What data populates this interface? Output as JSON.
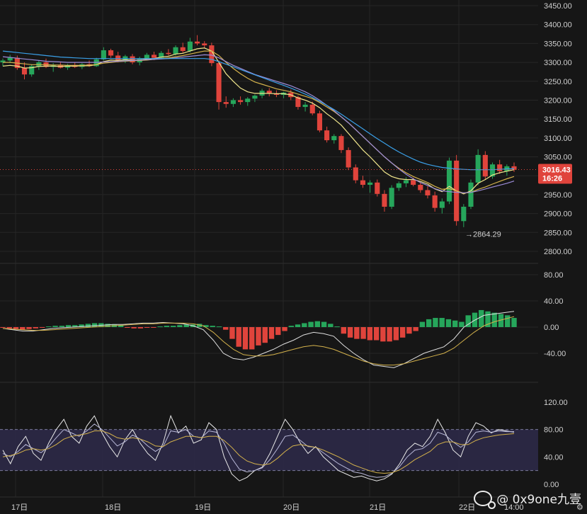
{
  "chart_data": [
    {
      "type": "candlestick",
      "panel": "price",
      "yticks": [
        "3450.00",
        "3400.00",
        "3350.00",
        "3300.00",
        "3250.00",
        "3200.00",
        "3150.00",
        "3100.00",
        "3050.00",
        "3000.00",
        "2950.00",
        "2900.00",
        "2850.00",
        "2800.00"
      ],
      "ylim": [
        2800,
        3450
      ],
      "last_price": "3016.43",
      "countdown": "16:26",
      "low_marker": "2864.29",
      "candles": [
        [
          3300,
          3310,
          3290,
          3305
        ],
        [
          3305,
          3320,
          3298,
          3312
        ],
        [
          3312,
          3318,
          3280,
          3285
        ],
        [
          3285,
          3300,
          3255,
          3268
        ],
        [
          3268,
          3295,
          3262,
          3290
        ],
        [
          3290,
          3305,
          3280,
          3300
        ],
        [
          3300,
          3310,
          3285,
          3288
        ],
        [
          3288,
          3298,
          3275,
          3292
        ],
        [
          3292,
          3300,
          3284,
          3286
        ],
        [
          3286,
          3296,
          3280,
          3293
        ],
        [
          3293,
          3300,
          3285,
          3288
        ],
        [
          3288,
          3298,
          3282,
          3295
        ],
        [
          3295,
          3305,
          3288,
          3290
        ],
        [
          3290,
          3312,
          3288,
          3308
        ],
        [
          3308,
          3340,
          3305,
          3332
        ],
        [
          3332,
          3336,
          3312,
          3318
        ],
        [
          3318,
          3328,
          3300,
          3305
        ],
        [
          3305,
          3320,
          3298,
          3316
        ],
        [
          3316,
          3322,
          3295,
          3300
        ],
        [
          3300,
          3315,
          3292,
          3310
        ],
        [
          3310,
          3325,
          3305,
          3320
        ],
        [
          3320,
          3328,
          3306,
          3312
        ],
        [
          3312,
          3330,
          3308,
          3325
        ],
        [
          3325,
          3335,
          3318,
          3322
        ],
        [
          3322,
          3345,
          3318,
          3340
        ],
        [
          3340,
          3352,
          3325,
          3330
        ],
        [
          3330,
          3365,
          3326,
          3355
        ],
        [
          3355,
          3372,
          3345,
          3350
        ],
        [
          3350,
          3356,
          3338,
          3345
        ],
        [
          3345,
          3352,
          3290,
          3298
        ],
        [
          3298,
          3305,
          3175,
          3195
        ],
        [
          3195,
          3210,
          3180,
          3190
        ],
        [
          3190,
          3205,
          3182,
          3200
        ],
        [
          3200,
          3210,
          3188,
          3195
        ],
        [
          3195,
          3208,
          3185,
          3204
        ],
        [
          3204,
          3215,
          3195,
          3212
        ],
        [
          3212,
          3230,
          3205,
          3225
        ],
        [
          3225,
          3232,
          3210,
          3218
        ],
        [
          3218,
          3226,
          3208,
          3214
        ],
        [
          3214,
          3222,
          3205,
          3220
        ],
        [
          3220,
          3228,
          3200,
          3208
        ],
        [
          3208,
          3212,
          3175,
          3182
        ],
        [
          3182,
          3195,
          3170,
          3188
        ],
        [
          3188,
          3196,
          3160,
          3165
        ],
        [
          3165,
          3172,
          3115,
          3120
        ],
        [
          3120,
          3130,
          3088,
          3094
        ],
        [
          3094,
          3110,
          3085,
          3105
        ],
        [
          3105,
          3110,
          3060,
          3068
        ],
        [
          3068,
          3075,
          3015,
          3022
        ],
        [
          3022,
          3030,
          2980,
          2988
        ],
        [
          2988,
          3000,
          2968,
          2976
        ],
        [
          2976,
          2988,
          2955,
          2982
        ],
        [
          2982,
          2990,
          2945,
          2952
        ],
        [
          2952,
          2962,
          2905,
          2918
        ],
        [
          2918,
          2975,
          2912,
          2968
        ],
        [
          2968,
          2985,
          2960,
          2980
        ],
        [
          2980,
          2996,
          2970,
          2988
        ],
        [
          2988,
          2995,
          2972,
          2976
        ],
        [
          2976,
          2982,
          2955,
          2962
        ],
        [
          2962,
          2972,
          2940,
          2948
        ],
        [
          2948,
          2958,
          2905,
          2915
        ],
        [
          2915,
          2940,
          2900,
          2932
        ],
        [
          2932,
          3048,
          2925,
          3040
        ],
        [
          3040,
          3055,
          2868,
          2880
        ],
        [
          2880,
          2925,
          2864,
          2918
        ],
        [
          2918,
          2990,
          2912,
          2982
        ],
        [
          2982,
          3070,
          2975,
          3055
        ],
        [
          3055,
          3065,
          2990,
          2998
        ],
        [
          2998,
          3035,
          2992,
          3030
        ],
        [
          3030,
          3042,
          3005,
          3012
        ],
        [
          3012,
          3030,
          3000,
          3025
        ],
        [
          3025,
          3035,
          3010,
          3016
        ]
      ],
      "series": [
        {
          "name": "",
          "color": "#f0e68c",
          "values": [
            3290,
            3292,
            3290,
            3285,
            3286,
            3289,
            3290,
            3290,
            3289,
            3290,
            3290,
            3291,
            3291,
            3294,
            3302,
            3306,
            3305,
            3307,
            3306,
            3306,
            3309,
            3310,
            3314,
            3316,
            3322,
            3324,
            3330,
            3336,
            3338,
            3330,
            3300,
            3270,
            3250,
            3232,
            3222,
            3218,
            3218,
            3218,
            3217,
            3217,
            3214,
            3206,
            3200,
            3192,
            3180,
            3164,
            3150,
            3134,
            3112,
            3090,
            3068,
            3050,
            3030,
            3010,
            2998,
            2992,
            2990,
            2990,
            2985,
            2978,
            2965,
            2958,
            2972,
            2960,
            2952,
            2960,
            2980,
            2990,
            3002,
            3008,
            3012,
            3016
          ]
        },
        {
          "name": "",
          "color": "#d4b24c",
          "values": [
            3300,
            3300,
            3298,
            3296,
            3294,
            3294,
            3294,
            3293,
            3293,
            3292,
            3292,
            3292,
            3293,
            3294,
            3298,
            3300,
            3302,
            3303,
            3304,
            3305,
            3306,
            3308,
            3310,
            3312,
            3315,
            3318,
            3322,
            3326,
            3330,
            3330,
            3318,
            3300,
            3284,
            3270,
            3258,
            3248,
            3242,
            3236,
            3230,
            3226,
            3222,
            3216,
            3210,
            3204,
            3194,
            3182,
            3170,
            3156,
            3140,
            3122,
            3104,
            3086,
            3068,
            3050,
            3034,
            3020,
            3008,
            2998,
            2990,
            2982,
            2972,
            2964,
            2966,
            2960,
            2954,
            2956,
            2964,
            2970,
            2978,
            2985,
            2992,
            2998
          ]
        },
        {
          "name": "",
          "color": "#9c8cd8",
          "values": [
            3315,
            3313,
            3311,
            3309,
            3307,
            3305,
            3303,
            3302,
            3301,
            3300,
            3300,
            3300,
            3300,
            3300,
            3301,
            3302,
            3303,
            3304,
            3305,
            3306,
            3307,
            3308,
            3309,
            3310,
            3312,
            3314,
            3316,
            3318,
            3320,
            3319,
            3312,
            3302,
            3292,
            3284,
            3276,
            3268,
            3262,
            3256,
            3250,
            3244,
            3238,
            3230,
            3222,
            3212,
            3200,
            3186,
            3172,
            3156,
            3140,
            3122,
            3104,
            3086,
            3068,
            3050,
            3034,
            3018,
            3004,
            2992,
            2982,
            2974,
            2966,
            2960,
            2958,
            2956,
            2955,
            2956,
            2960,
            2965,
            2970,
            2975,
            2980,
            2986
          ]
        },
        {
          "name": "",
          "color": "#3aa0e8",
          "values": [
            3330,
            3328,
            3326,
            3324,
            3322,
            3320,
            3318,
            3316,
            3314,
            3313,
            3312,
            3311,
            3310,
            3310,
            3310,
            3310,
            3310,
            3310,
            3310,
            3310,
            3310,
            3310,
            3310,
            3310,
            3310,
            3310,
            3310,
            3310,
            3310,
            3308,
            3302,
            3295,
            3288,
            3281,
            3274,
            3267,
            3260,
            3253,
            3246,
            3239,
            3232,
            3224,
            3216,
            3207,
            3197,
            3186,
            3175,
            3163,
            3150,
            3137,
            3124,
            3111,
            3098,
            3086,
            3074,
            3063,
            3053,
            3044,
            3036,
            3030,
            3026,
            3022,
            3020,
            3018,
            3017,
            3016,
            3016,
            3016,
            3016,
            3017,
            3018,
            3019
          ]
        }
      ]
    },
    {
      "type": "bar",
      "panel": "macd",
      "yticks": [
        "80.00",
        "40.00",
        "0.00",
        "-40.00"
      ],
      "ylim": [
        -75,
        110
      ],
      "hist": [
        -1,
        -2,
        -3,
        -4,
        -3,
        -2,
        -1,
        1,
        2,
        2,
        3,
        3,
        4,
        5,
        6,
        6,
        5,
        4,
        3,
        -1,
        -2,
        -2,
        -1,
        -1,
        1,
        2,
        2,
        3,
        4,
        4,
        5,
        3,
        2,
        1,
        -4,
        -18,
        -30,
        -34,
        -34,
        -28,
        -24,
        -18,
        -12,
        -6,
        2,
        4,
        6,
        8,
        9,
        8,
        5,
        1,
        -10,
        -16,
        -18,
        -18,
        -20,
        -20,
        -22,
        -22,
        -20,
        -16,
        -10,
        -6,
        8,
        12,
        14,
        14,
        12,
        10,
        8,
        18,
        22,
        26,
        24,
        22,
        20,
        18,
        14
      ],
      "series": [
        {
          "name": "",
          "color": "#e0e0e0",
          "values": [
            -2,
            -4,
            -6,
            -6,
            -4,
            -2,
            -1,
            0,
            1,
            2,
            3,
            4,
            4,
            5,
            6,
            6,
            7,
            6,
            5,
            2,
            -4,
            -20,
            -40,
            -48,
            -50,
            -46,
            -40,
            -34,
            -26,
            -20,
            -12,
            -8,
            -10,
            -14,
            -28,
            -40,
            -50,
            -58,
            -60,
            -62,
            -56,
            -48,
            -40,
            -35,
            -30,
            -18,
            0,
            10,
            18,
            20,
            22,
            24
          ]
        },
        {
          "name": "",
          "color": "#d4b24c",
          "values": [
            -2,
            -3,
            -4,
            -5,
            -5,
            -4,
            -3,
            -2,
            -1,
            0,
            1,
            2,
            3,
            4,
            5,
            5,
            6,
            6,
            6,
            5,
            2,
            -8,
            -22,
            -34,
            -42,
            -44,
            -44,
            -42,
            -38,
            -34,
            -30,
            -28,
            -30,
            -34,
            -40,
            -46,
            -52,
            -56,
            -58,
            -58,
            -56,
            -52,
            -48,
            -44,
            -40,
            -32,
            -20,
            -8,
            2,
            8,
            12,
            16
          ]
        }
      ]
    },
    {
      "type": "line",
      "panel": "rsi",
      "yticks": [
        "120.00",
        "80.00",
        "40.00",
        "0.00"
      ],
      "ylim": [
        -5,
        130
      ],
      "band": [
        20,
        80
      ],
      "series": [
        {
          "name": "",
          "color": "#e8e8e8",
          "values": [
            50,
            30,
            55,
            70,
            45,
            35,
            60,
            80,
            95,
            70,
            60,
            85,
            100,
            75,
            55,
            40,
            65,
            80,
            60,
            45,
            35,
            60,
            100,
            75,
            85,
            60,
            65,
            90,
            80,
            40,
            15,
            5,
            10,
            20,
            25,
            45,
            70,
            95,
            80,
            60,
            45,
            55,
            40,
            30,
            20,
            15,
            10,
            12,
            8,
            5,
            8,
            15,
            30,
            50,
            60,
            55,
            70,
            95,
            75,
            50,
            40,
            70,
            90,
            85,
            75,
            80,
            78,
            76
          ]
        },
        {
          "name": "",
          "color": "#b8b8d8",
          "values": [
            45,
            40,
            48,
            58,
            52,
            46,
            55,
            68,
            80,
            75,
            70,
            78,
            88,
            80,
            68,
            56,
            62,
            72,
            66,
            56,
            48,
            55,
            78,
            76,
            80,
            70,
            68,
            78,
            76,
            60,
            38,
            22,
            18,
            20,
            24,
            36,
            52,
            70,
            72,
            64,
            55,
            54,
            46,
            38,
            30,
            24,
            18,
            16,
            12,
            10,
            11,
            16,
            26,
            40,
            50,
            52,
            60,
            76,
            72,
            62,
            54,
            62,
            76,
            78,
            76,
            78,
            77,
            77
          ]
        },
        {
          "name": "",
          "color": "#d4b24c",
          "values": [
            40,
            42,
            45,
            50,
            52,
            50,
            52,
            58,
            66,
            70,
            72,
            74,
            78,
            78,
            74,
            68,
            66,
            68,
            66,
            62,
            56,
            55,
            62,
            66,
            70,
            70,
            68,
            70,
            70,
            64,
            54,
            42,
            34,
            30,
            28,
            30,
            38,
            48,
            56,
            58,
            56,
            54,
            50,
            45,
            40,
            34,
            28,
            24,
            20,
            17,
            16,
            17,
            21,
            28,
            36,
            42,
            48,
            58,
            62,
            62,
            58,
            58,
            64,
            68,
            70,
            72,
            73,
            74
          ]
        }
      ]
    }
  ],
  "time_axis": {
    "labels": [
      "17日",
      "18日",
      "19日",
      "20日",
      "21日",
      "22日",
      "14:00"
    ]
  },
  "watermark": "@ 0x9one九壹",
  "colors": {
    "background": "#161616",
    "up": "#26a65b",
    "down": "#e0443c",
    "grid": "#262626",
    "price_tag": "#e0443c",
    "rsi_band": "#2e2a4a"
  }
}
